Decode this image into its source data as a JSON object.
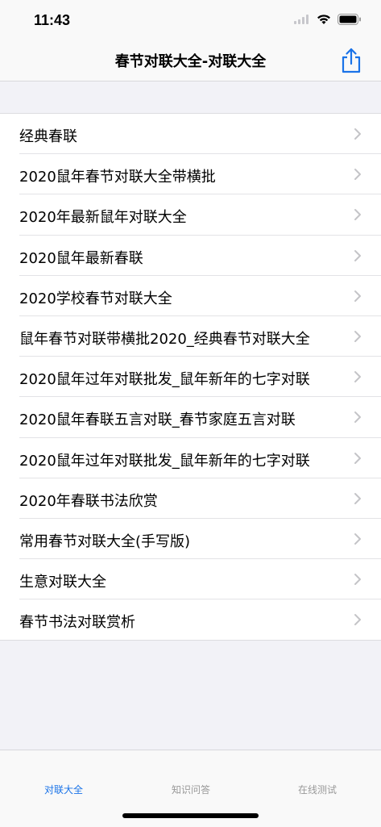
{
  "status_bar": {
    "time": "11:43"
  },
  "nav": {
    "title": "春节对联大全-对联大全"
  },
  "list": {
    "items": [
      {
        "label": "经典春联"
      },
      {
        "label": "2020鼠年春节对联大全带横批"
      },
      {
        "label": "2020年最新鼠年对联大全"
      },
      {
        "label": "2020鼠年最新春联"
      },
      {
        "label": "2020学校春节对联大全"
      },
      {
        "label": "鼠年春节对联带横批2020_经典春节对联大全"
      },
      {
        "label": "2020鼠年过年对联批发_鼠年新年的七字对联"
      },
      {
        "label": "2020鼠年春联五言对联_春节家庭五言对联"
      },
      {
        "label": "2020鼠年过年对联批发_鼠年新年的七字对联"
      },
      {
        "label": "2020年春联书法欣赏"
      },
      {
        "label": "常用春节对联大全(手写版)"
      },
      {
        "label": "生意对联大全"
      },
      {
        "label": "春节书法对联赏析"
      }
    ]
  },
  "tabs": [
    {
      "label": "对联大全",
      "active": true
    },
    {
      "label": "知识问答",
      "active": false
    },
    {
      "label": "在线测试",
      "active": false
    }
  ],
  "colors": {
    "accent": "#1a73e8",
    "inactive_tab": "#999999",
    "chevron": "#c4c4c7"
  },
  "icons": [
    "signal-icon",
    "wifi-icon",
    "battery-icon",
    "share-icon",
    "chevron-right-icon"
  ]
}
